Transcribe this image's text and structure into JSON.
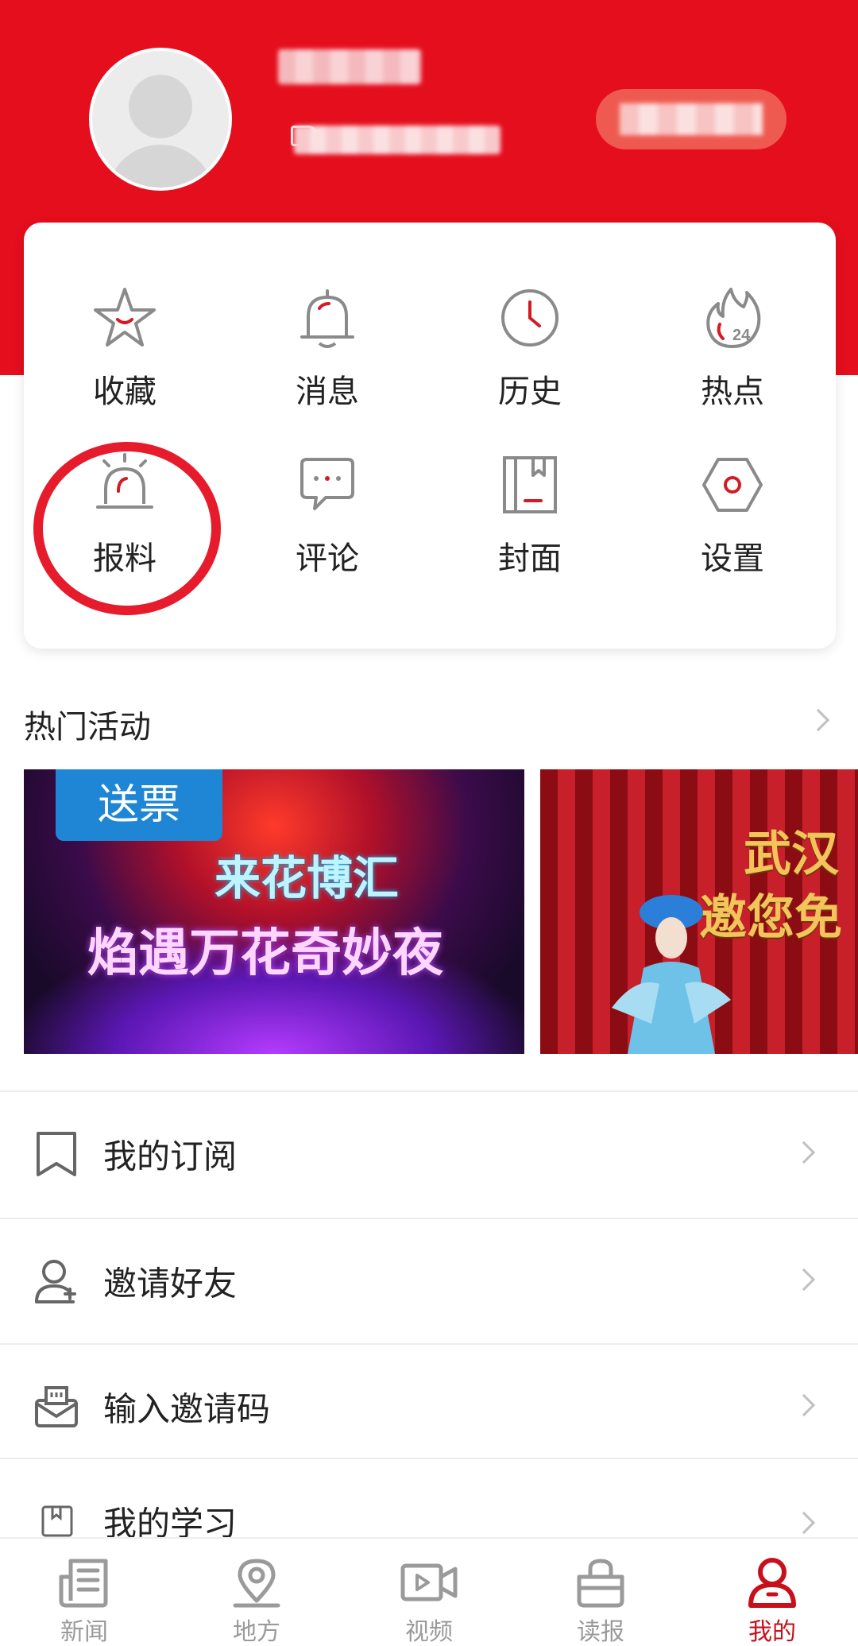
{
  "colors": {
    "brand_red": "#e50e1d",
    "active_tab": "#c8101c",
    "inactive_tab": "#9a9a9a",
    "icon_gray": "#8a8a8a"
  },
  "menu": {
    "items": [
      {
        "label": "收藏",
        "icon": "star-icon"
      },
      {
        "label": "消息",
        "icon": "bell-icon"
      },
      {
        "label": "历史",
        "icon": "clock-icon"
      },
      {
        "label": "热点",
        "icon": "flame-24-icon",
        "badge": "24"
      },
      {
        "label": "报料",
        "icon": "alarm-light-icon"
      },
      {
        "label": "评论",
        "icon": "chat-bubble-icon"
      },
      {
        "label": "封面",
        "icon": "book-cover-icon"
      },
      {
        "label": "设置",
        "icon": "hexagon-gear-icon"
      }
    ]
  },
  "activities": {
    "title": "热门活动",
    "banners": [
      {
        "tag": "送票",
        "line1": "来花博汇",
        "line2": "焰遇万花奇妙夜"
      },
      {
        "line1": "武汉",
        "line2": "邀您免"
      }
    ]
  },
  "list": {
    "items": [
      {
        "label": "我的订阅",
        "icon": "bookmark-icon"
      },
      {
        "label": "邀请好友",
        "icon": "add-user-icon"
      },
      {
        "label": "输入邀请码",
        "icon": "envelope-code-icon"
      },
      {
        "label": "我的学习",
        "icon": "study-book-icon"
      }
    ]
  },
  "tabbar": {
    "items": [
      {
        "label": "新闻",
        "icon": "newspaper-icon"
      },
      {
        "label": "地方",
        "icon": "location-icon"
      },
      {
        "label": "视频",
        "icon": "video-icon"
      },
      {
        "label": "读报",
        "icon": "read-paper-icon"
      },
      {
        "label": "我的",
        "icon": "profile-icon",
        "active": true
      }
    ]
  }
}
